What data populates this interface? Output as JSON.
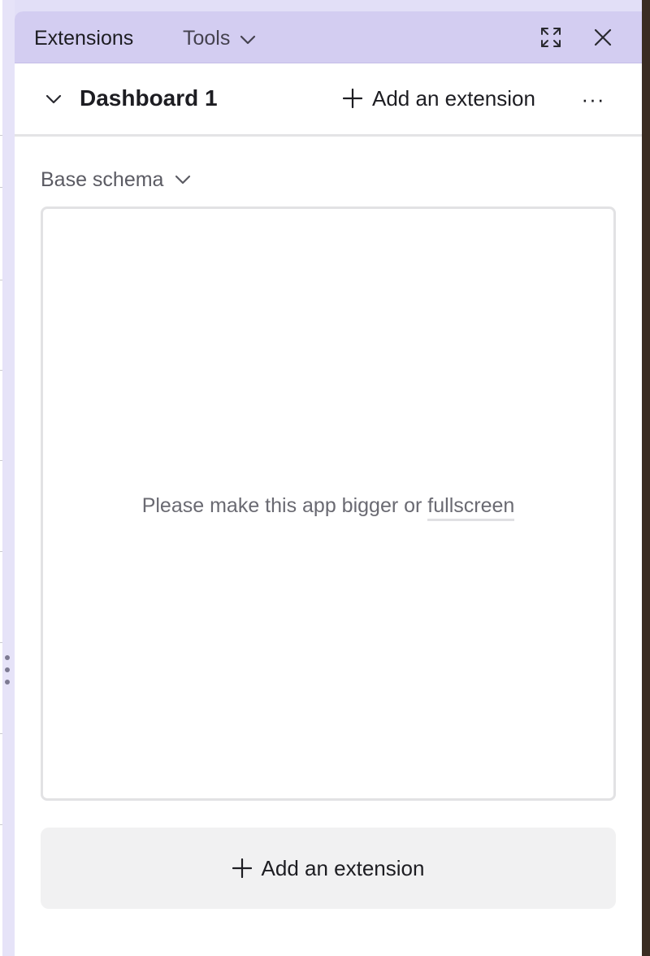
{
  "tabs": {
    "extensions_label": "Extensions",
    "tools_label": "Tools"
  },
  "window_controls": {
    "expand_icon": "expand-icon",
    "close_icon": "close-icon"
  },
  "dashboard": {
    "title": "Dashboard 1",
    "add_extension_label": "Add an extension",
    "more_label": "···"
  },
  "extension": {
    "schema_label": "Base schema",
    "message_prefix": "Please make this app bigger or ",
    "message_link": "fullscreen"
  },
  "footer": {
    "add_extension_label": "Add an extension"
  },
  "colors": {
    "header_bg": "#d3cdf1",
    "panel_bg": "#ffffff",
    "muted_text": "#6a6a72"
  }
}
